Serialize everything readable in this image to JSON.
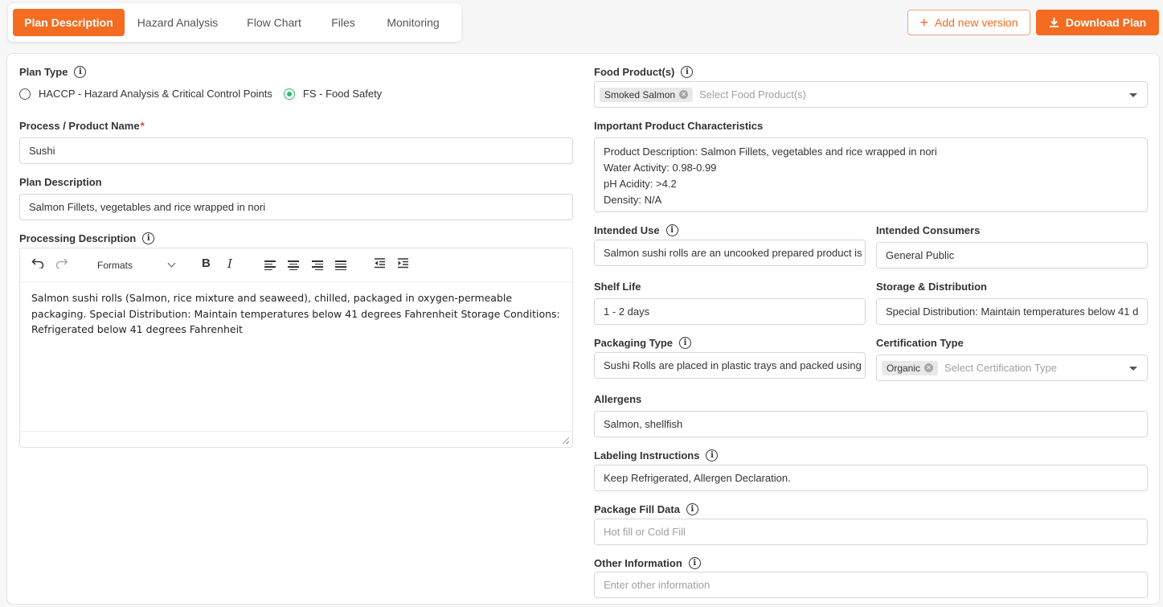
{
  "tabs": [
    {
      "label": "Plan Description",
      "active": true
    },
    {
      "label": "Hazard Analysis",
      "active": false
    },
    {
      "label": "Flow Chart",
      "active": false
    },
    {
      "label": "Files",
      "active": false
    },
    {
      "label": "Monitoring",
      "active": false
    }
  ],
  "actions": {
    "add_version": "Add new version",
    "download": "Download Plan"
  },
  "left": {
    "plan_type": {
      "label": "Plan Type",
      "options": [
        "HACCP - Hazard Analysis & Critical Control Points",
        "FS - Food Safety"
      ],
      "selected": "FS - Food Safety"
    },
    "process_name": {
      "label": "Process / Product Name",
      "required_mark": "*",
      "value": "Sushi"
    },
    "plan_description": {
      "label": "Plan Description",
      "value": "Salmon Fillets, vegetables and rice wrapped in nori"
    },
    "processing_description": {
      "label": "Processing Description",
      "formats_label": "Formats",
      "body": "Salmon sushi rolls (Salmon, rice mixture and seaweed), chilled, packaged in oxygen-permeable packaging. Special Distribution: Maintain temperatures below 41 degrees Fahrenheit Storage Conditions: Refrigerated below 41 degrees Fahrenheit"
    }
  },
  "right": {
    "food_products": {
      "label": "Food Product(s)",
      "chip": "Smoked Salmon",
      "placeholder": "Select Food Product(s)"
    },
    "important_characteristics": {
      "label": "Important Product Characteristics",
      "lines": [
        "Product Description: Salmon Fillets, vegetables and rice wrapped in nori",
        "Water Activity: 0.98-0.99",
        "pH Acidity: >4.2",
        "Density: N/A"
      ]
    },
    "intended_use": {
      "label": "Intended Use",
      "value": "Salmon sushi rolls are an uncooked prepared product is"
    },
    "intended_consumers": {
      "label": "Intended Consumers",
      "value": "General Public"
    },
    "shelf_life": {
      "label": "Shelf Life",
      "value": "1 - 2 days"
    },
    "storage_distribution": {
      "label": "Storage & Distribution",
      "value": "Special Distribution: Maintain temperatures below 41 d"
    },
    "packaging_type": {
      "label": "Packaging Type",
      "value": "Sushi Rolls are placed in plastic trays and packed using"
    },
    "certification_type": {
      "label": "Certification Type",
      "chip": "Organic",
      "placeholder": "Select Certification Type"
    },
    "allergens": {
      "label": "Allergens",
      "value": "Salmon, shellfish"
    },
    "labeling": {
      "label": "Labeling Instructions",
      "value": "Keep Refrigerated, Allergen Declaration."
    },
    "package_fill": {
      "label": "Package Fill Data",
      "placeholder": "Hot fill or Cold Fill"
    },
    "other_info": {
      "label": "Other Information",
      "placeholder": "Enter other information"
    }
  },
  "colors": {
    "accent": "#f36c21",
    "radio_selected": "#2bb673",
    "required": "#e53935"
  }
}
